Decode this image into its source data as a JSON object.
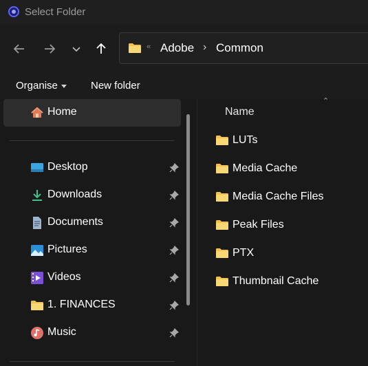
{
  "window": {
    "title": "Select Folder"
  },
  "address": {
    "overflow": "«",
    "crumbs": [
      "Adobe",
      "Common"
    ]
  },
  "toolbar": {
    "organise_label": "Organise",
    "new_folder_label": "New folder"
  },
  "sidebar": {
    "home": {
      "label": "Home",
      "icon": "home-icon"
    },
    "items": [
      {
        "label": "Desktop",
        "icon": "desktop-icon",
        "pinned": true
      },
      {
        "label": "Downloads",
        "icon": "download-icon",
        "pinned": true
      },
      {
        "label": "Documents",
        "icon": "document-icon",
        "pinned": true
      },
      {
        "label": "Pictures",
        "icon": "picture-icon",
        "pinned": true
      },
      {
        "label": "Videos",
        "icon": "video-icon",
        "pinned": true
      },
      {
        "label": "1. FINANCES",
        "icon": "folder-icon",
        "pinned": true
      },
      {
        "label": "Music",
        "icon": "music-icon",
        "pinned": true
      }
    ]
  },
  "content": {
    "column_header": "Name",
    "folders": [
      "LUTs",
      "Media Cache",
      "Media Cache Files",
      "Peak Files",
      "PTX",
      "Thumbnail Cache"
    ]
  },
  "colors": {
    "folder": "#f4c04e",
    "background": "#191919",
    "selected": "#2d2d2d"
  }
}
